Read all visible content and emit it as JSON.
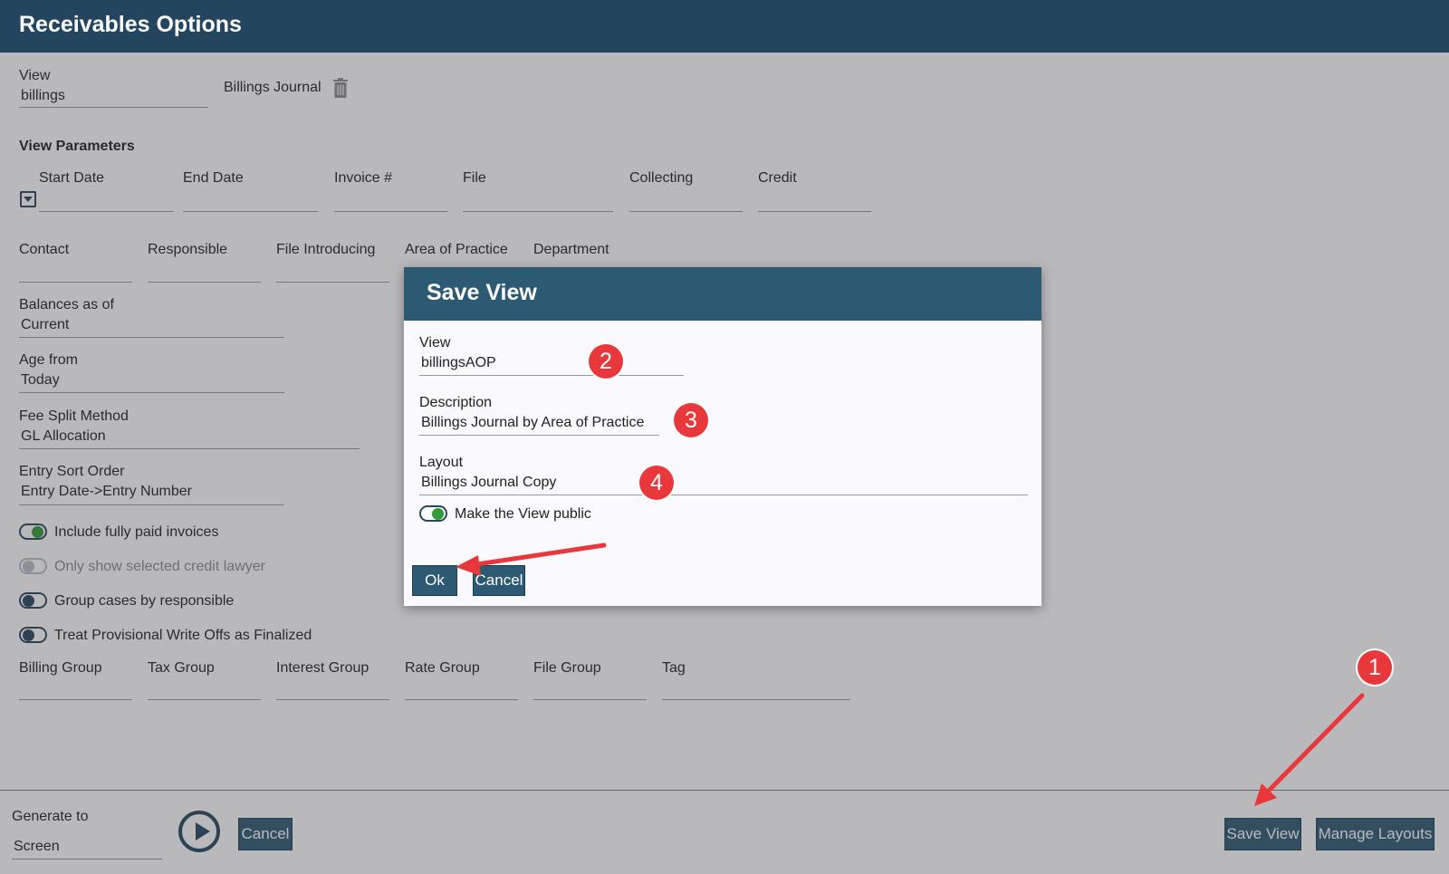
{
  "header": {
    "title": "Receivables Options"
  },
  "view_field": {
    "label": "View",
    "value": "billings"
  },
  "view_name": "Billings Journal",
  "icons": {
    "delete": "trash-icon",
    "expand": "dropdown-toggle-icon",
    "run": "play-icon"
  },
  "view_parameters": {
    "heading": "View Parameters",
    "row1": [
      "Start Date",
      "End Date",
      "Invoice #",
      "File",
      "Collecting",
      "Credit"
    ],
    "row2": [
      "Contact",
      "Responsible",
      "File Introducing",
      "Area of Practice",
      "Department"
    ]
  },
  "settings": [
    {
      "label": "Balances as of",
      "value": "Current"
    },
    {
      "label": "Age from",
      "value": "Today"
    },
    {
      "label": "Fee Split Method",
      "value": "GL Allocation"
    },
    {
      "label": "Entry Sort Order",
      "value": "Entry Date->Entry Number"
    }
  ],
  "toggles": [
    {
      "label": "Include fully paid invoices",
      "state": "on"
    },
    {
      "label": "Only show selected credit lawyer",
      "state": "disabled"
    },
    {
      "label": "Group cases by responsible",
      "state": "off"
    },
    {
      "label": "Treat Provisional Write Offs as Finalized",
      "state": "off"
    }
  ],
  "groups": [
    "Billing Group",
    "Tax Group",
    "Interest Group",
    "Rate Group",
    "File Group",
    "Tag"
  ],
  "footer": {
    "generate_label": "Generate to",
    "generate_value": "Screen",
    "cancel": "Cancel",
    "save_view": "Save View",
    "manage_layouts": "Manage Layouts"
  },
  "dialog": {
    "title": "Save View",
    "view_label": "View",
    "view_value": "billingsAOP",
    "description_label": "Description",
    "description_value": "Billings Journal by Area of Practice",
    "layout_label": "Layout",
    "layout_value": "Billings Journal Copy",
    "public_label": "Make the View public",
    "public_state": "on",
    "ok": "Ok",
    "cancel": "Cancel"
  },
  "annotations": {
    "badges": [
      "1",
      "2",
      "3",
      "4"
    ],
    "accent": "#e8383c"
  },
  "colors": {
    "header": "#23465e",
    "button": "#2c5a73",
    "toggle_on": "#2f9c36"
  }
}
